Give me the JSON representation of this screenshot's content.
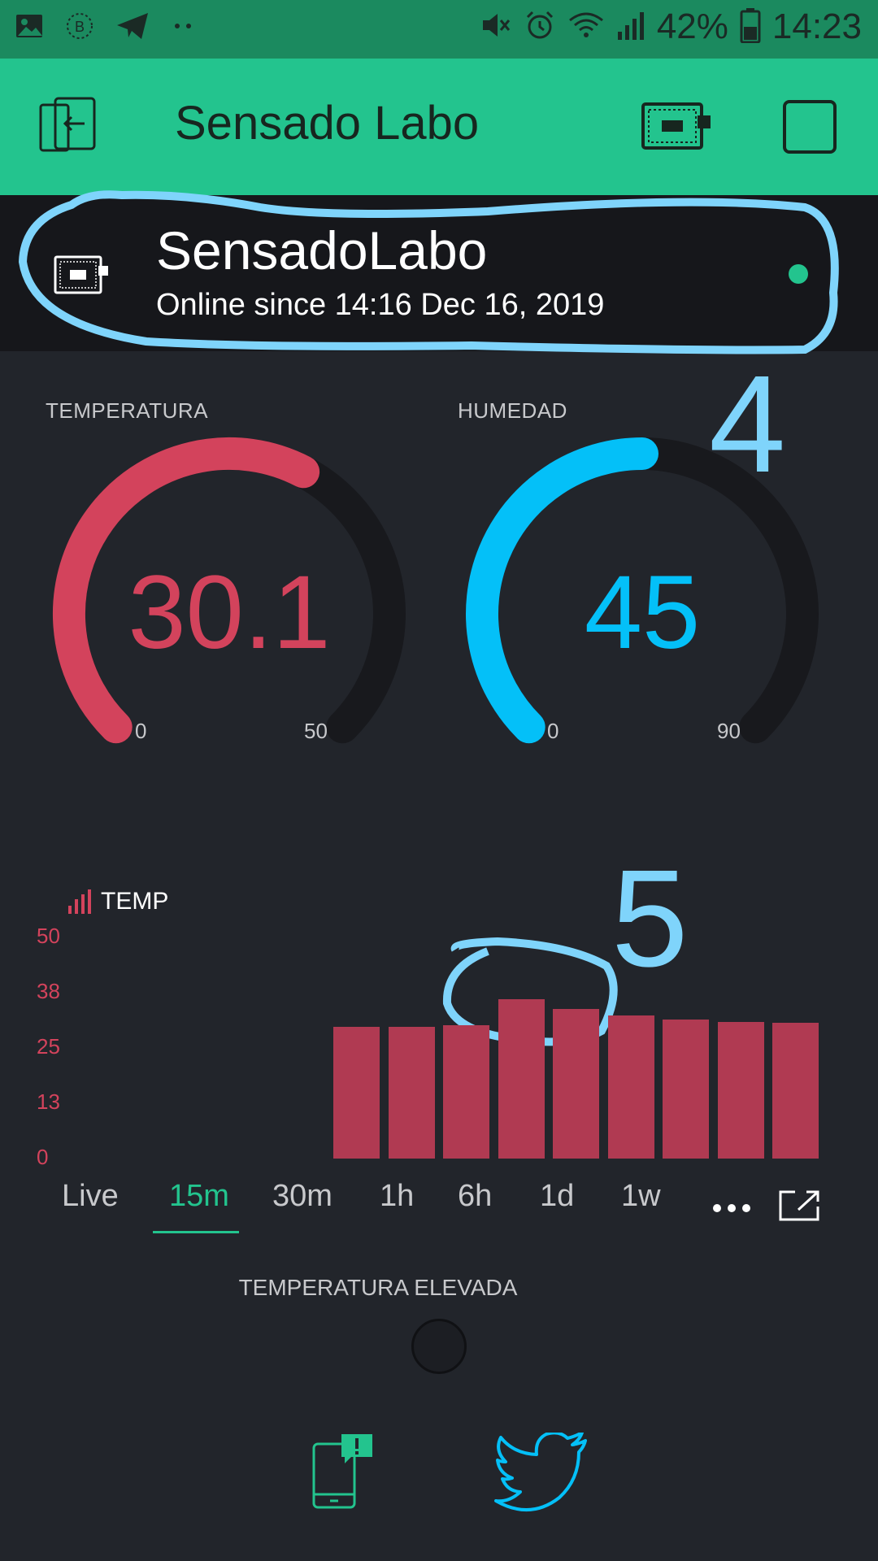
{
  "status_bar": {
    "battery": "42%",
    "time": "14:23"
  },
  "app_bar": {
    "title": "Sensado Labo"
  },
  "device": {
    "name": "SensadoLabo",
    "status": "Online since 14:16 Dec 16, 2019",
    "online_color": "#23c48e"
  },
  "annotations": {
    "marker_4": "4",
    "marker_5": "5"
  },
  "gauges": [
    {
      "label": "TEMPERATURA",
      "value": "30.1",
      "value_num": 30.1,
      "min": "0",
      "max": "50",
      "min_num": 0,
      "max_num": 50,
      "color": "#d3435c"
    },
    {
      "label": "HUMEDAD",
      "value": "45",
      "value_num": 45,
      "min": "0",
      "max": "90",
      "min_num": 0,
      "max_num": 90,
      "color": "#04c0f8"
    }
  ],
  "chart_data": {
    "type": "bar",
    "title": "TEMP",
    "y_ticks": [
      "50",
      "38",
      "25",
      "13",
      "0"
    ],
    "ylim": [
      0,
      50
    ],
    "values": [
      29.5,
      29.4,
      29.9,
      35.6,
      33.4,
      32.0,
      31.1,
      30.6,
      30.3
    ],
    "color": "#b03a52",
    "grid": false
  },
  "time_tabs": [
    "Live",
    "15m",
    "30m",
    "1h",
    "6h",
    "1d",
    "1w"
  ],
  "active_tab": "15m",
  "alert": {
    "label": "TEMPERATURA ELEVADA"
  },
  "bottom_icons": [
    "push-notification-icon",
    "twitter-icon"
  ],
  "colors": {
    "accent": "#23c48e",
    "temperature": "#d3435c",
    "humidity": "#04c0f8",
    "background": "#22252b",
    "annotation": "#7fd4fb"
  }
}
